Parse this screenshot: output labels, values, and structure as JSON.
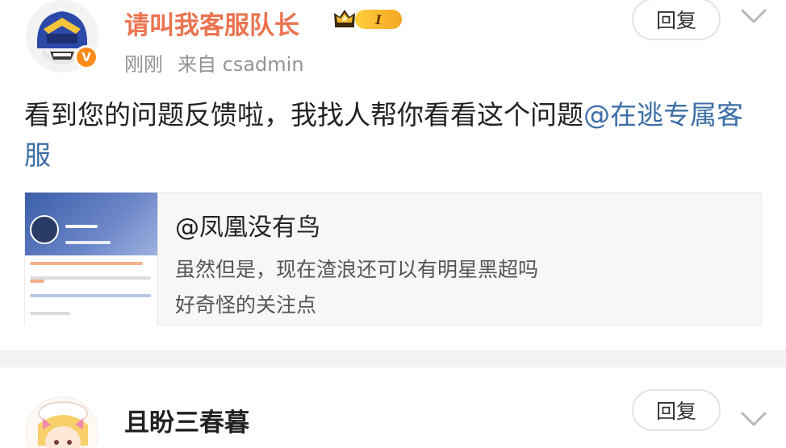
{
  "comments": [
    {
      "username": "请叫我客服队长",
      "level": "I",
      "verified_badge": "V",
      "time": "刚刚",
      "source": "来自 csadmin",
      "text": "看到您的问题反馈啦，我找人帮你看看这个问题",
      "mention": "@在逃专属客服",
      "reply_label": "回复",
      "card": {
        "title": "@凤凰没有鸟",
        "line1": "虽然但是，现在渣浪还可以有明星黑超吗",
        "line2": "好奇怪的关注点"
      }
    },
    {
      "username": "且盼三春暮",
      "reply_label": "回复"
    }
  ],
  "colors": {
    "username_accent": "#eb7350",
    "mention_link": "#3c6fa6",
    "verified_orange": "#ff8c1a",
    "level_gold": "#f5a623"
  },
  "icons": [
    "avatar-helmet",
    "verified-badge",
    "crown-icon",
    "level-badge",
    "chevron-down-icon"
  ]
}
